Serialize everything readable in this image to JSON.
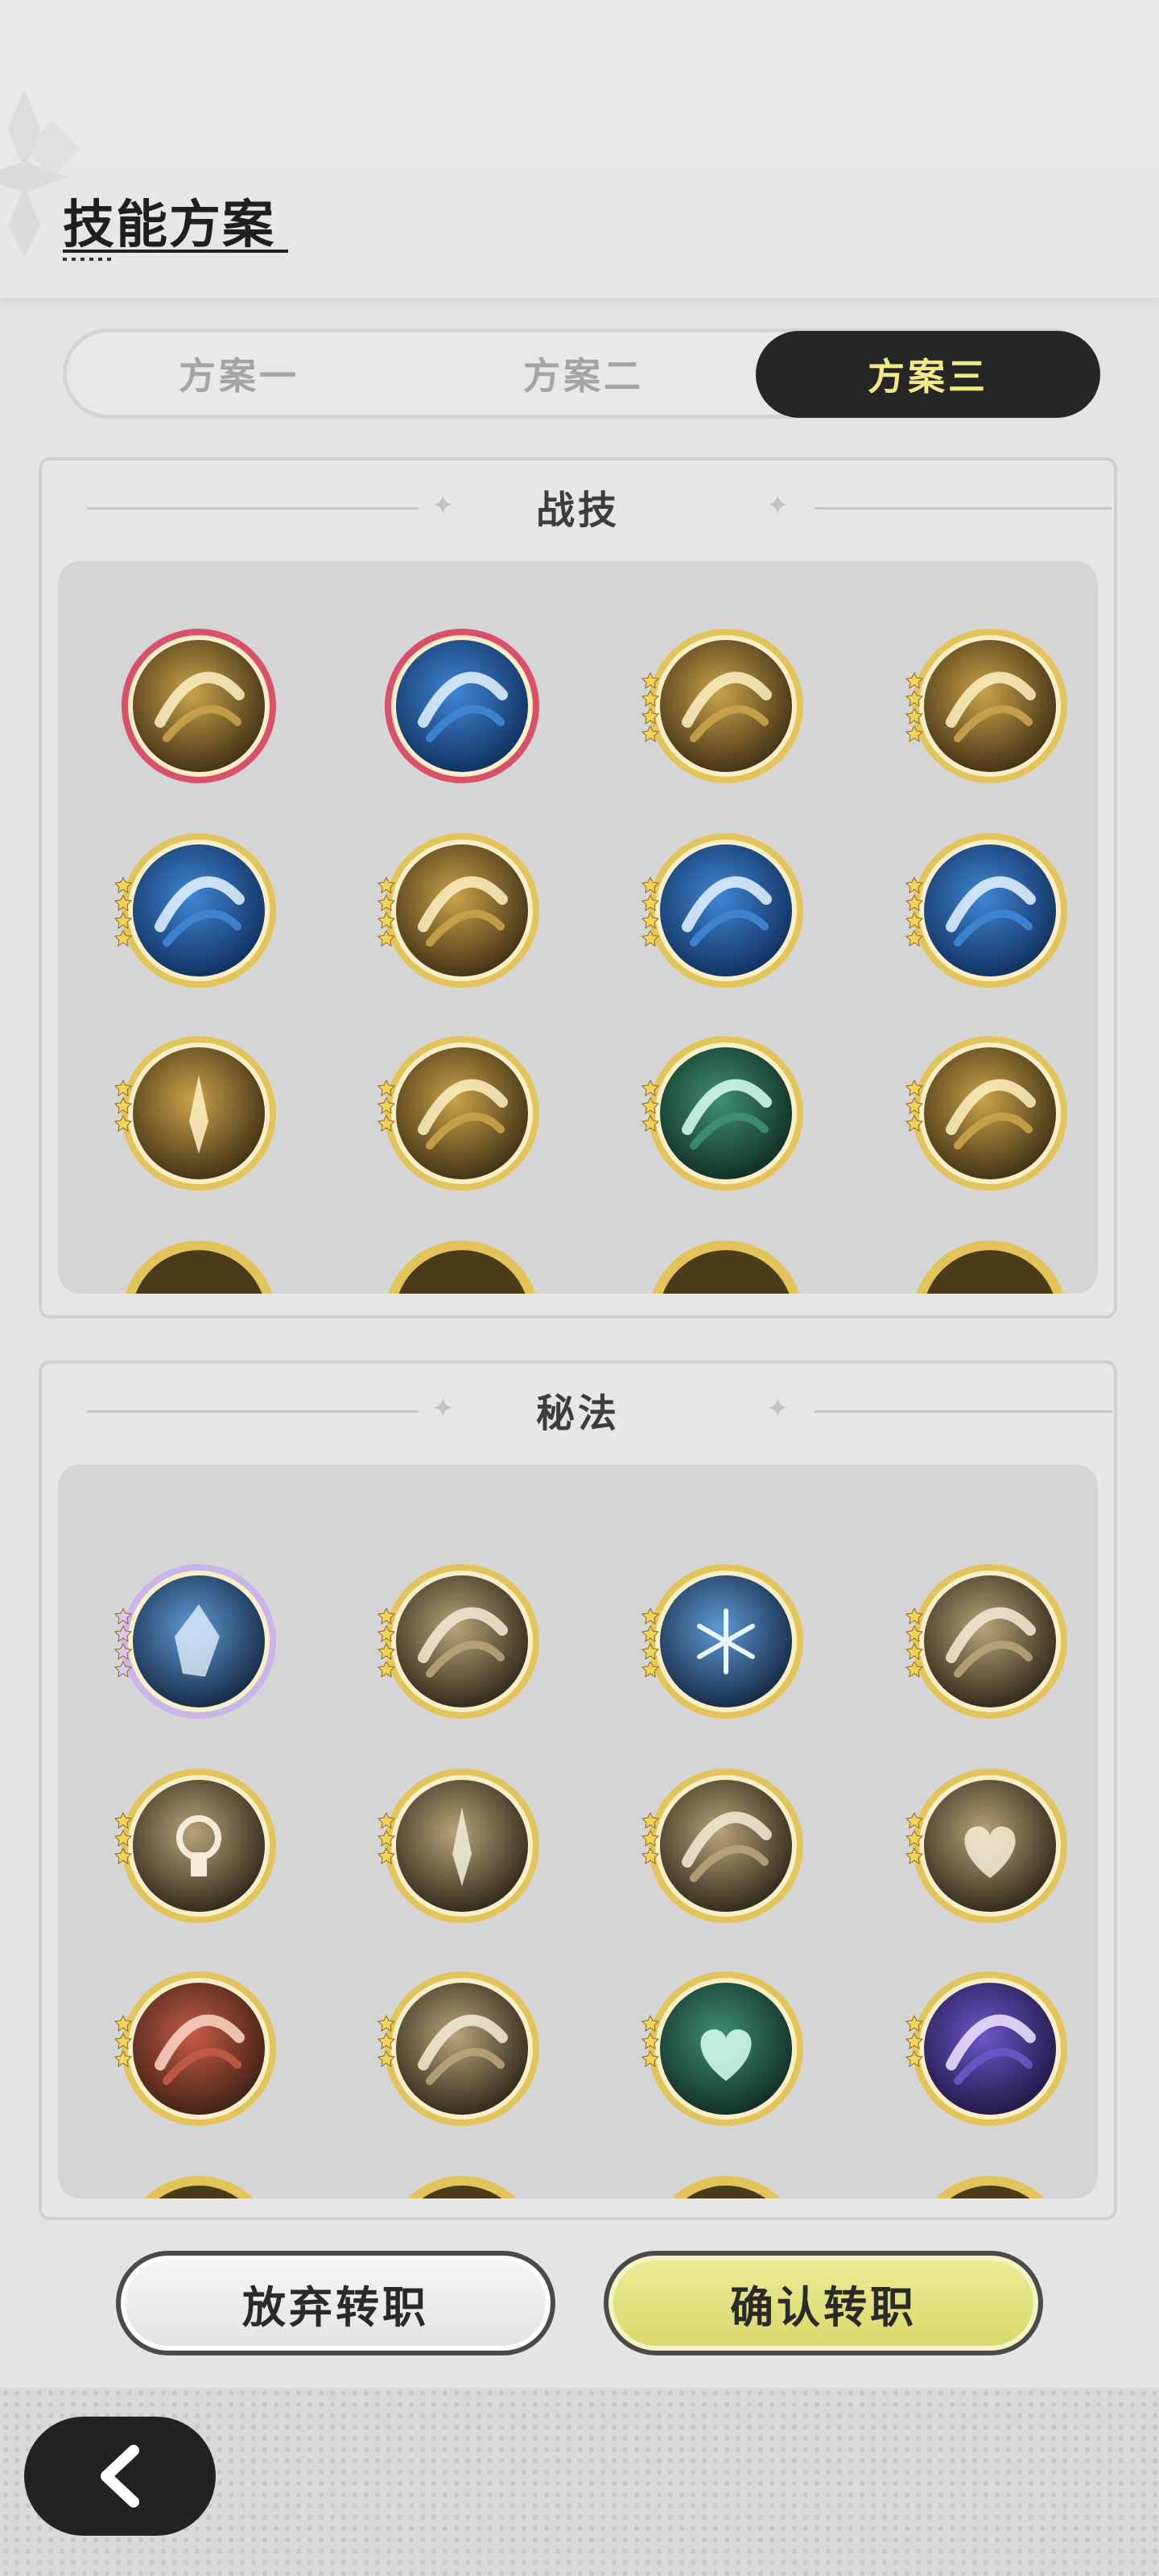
{
  "header": {
    "title": "技能方案"
  },
  "tabs": [
    {
      "label": "方案一",
      "active": false
    },
    {
      "label": "方案二",
      "active": false
    },
    {
      "label": "方案三",
      "active": true
    }
  ],
  "sections": [
    {
      "title": "战技",
      "icons": [
        "golden-crescent-slash-icon",
        "blue-vortex-orb-icon",
        "golden-swirl-wind-icon",
        "golden-burst-strike-icon",
        "blue-wave-icon",
        "golden-triple-strike-icon",
        "blue-lightning-burst-icon",
        "blue-star-vortex-icon",
        "golden-sword-burst-icon",
        "golden-wind-slash-icon",
        "green-dash-icon",
        "golden-spike-eruption-icon"
      ],
      "rarity": [
        "red-ring",
        "red-ring",
        "4-star",
        "4-star",
        "4-star",
        "4-star",
        "4-star",
        "4-star",
        "3-star",
        "3-star",
        "3-star",
        "3-star"
      ]
    },
    {
      "title": "秘法",
      "icons": [
        "ice-crystal-icon",
        "beast-fang-icon",
        "snowflake-icon",
        "golem-icon",
        "keyhole-icon",
        "dagger-icon",
        "shadow-blade-icon",
        "heart-shield-icon",
        "red-scroll-icon",
        "armor-icon",
        "green-heart-heal-icon",
        "purple-dragon-icon"
      ],
      "rarity": [
        "rainbow-4-star",
        "4-star",
        "4-star",
        "4-star",
        "3-star",
        "3-star",
        "3-star",
        "3-star",
        "3-star",
        "3-star",
        "3-star",
        "3-star"
      ]
    }
  ],
  "buttons": {
    "abandon": "放弃转职",
    "confirm": "确认转职"
  },
  "colors": {
    "active_tab_bg": "#262626",
    "active_tab_text": "#efe98a",
    "confirm_bg": "#dcdb70",
    "gold_ring": "#e3c45a",
    "red_ring": "#d9506a"
  }
}
